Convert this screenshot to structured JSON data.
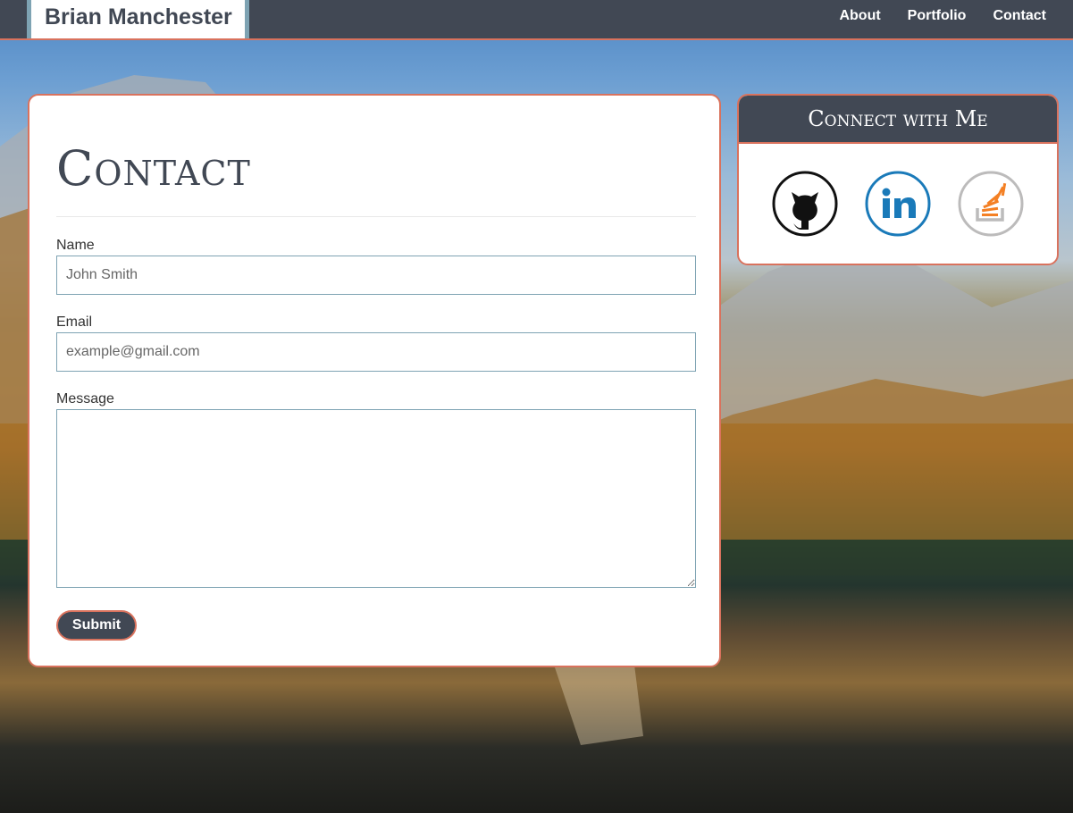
{
  "navbar": {
    "brand": "Brian Manchester",
    "links": [
      "About",
      "Portfolio",
      "Contact"
    ]
  },
  "contact": {
    "title": "Contact",
    "name_label": "Name",
    "name_placeholder": "John Smith",
    "email_label": "Email",
    "email_placeholder": "example@gmail.com",
    "message_label": "Message",
    "submit_label": "Submit"
  },
  "connect": {
    "title": "Connect with Me",
    "icons": [
      "github-icon",
      "linkedin-icon",
      "stackoverflow-icon"
    ]
  },
  "colors": {
    "navbar_bg": "#414854",
    "accent": "#d9725d",
    "brand_border": "#7ea3b3",
    "linkedin": "#1a7ab9",
    "stackoverflow_orange": "#f48024"
  }
}
